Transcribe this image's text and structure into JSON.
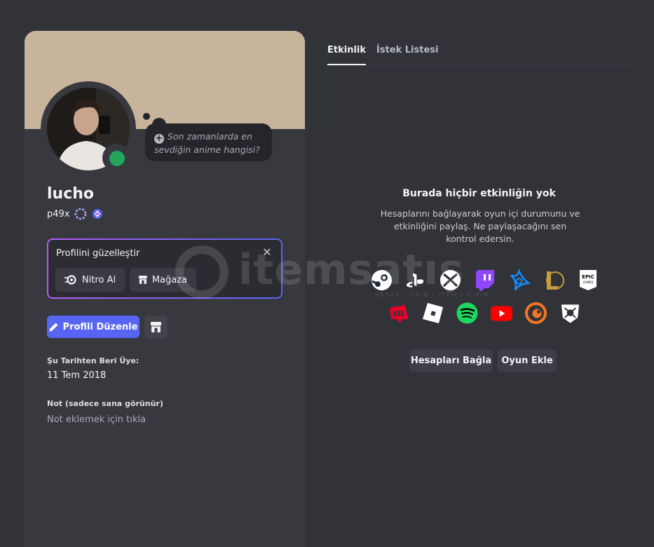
{
  "profile": {
    "display_name": "lucho",
    "username": "p49x",
    "status_prompt": "Son zamanlarda en sevdiğin anime hangisi?",
    "customize_title": "Profilini güzelleştir",
    "nitro_label": "Nitro Al",
    "shop_label": "Mağaza",
    "edit_label": "Profili Düzenle",
    "member_since_label": "Şu Tarihten Beri Üye:",
    "member_since_value": "11 Tem 2018",
    "note_label": "Not (sadece sana görünür)",
    "note_placeholder": "Not eklemek için tıkla",
    "status": "online"
  },
  "tabs": [
    {
      "label": "Etkinlik",
      "active": true
    },
    {
      "label": "İstek Listesi",
      "active": false
    }
  ],
  "activity": {
    "empty_title": "Burada hiçbir etkinliğin yok",
    "empty_desc": "Hesaplarını bağlayarak oyun içi durumunu ve etkinliğini paylaş. Ne paylaşacağını sen kontrol edersin.",
    "connect_label": "Hesapları Bağla",
    "add_game_label": "Oyun Ekle",
    "services_row1": [
      "steam-icon",
      "playstation-icon",
      "xbox-icon",
      "twitch-icon",
      "battlenet-icon",
      "league-of-legends-icon",
      "epic-games-icon"
    ],
    "services_row2": [
      "riot-games-icon",
      "roblox-icon",
      "spotify-icon",
      "youtube-icon",
      "crunchyroll-icon",
      "bungie-icon"
    ]
  },
  "watermark": {
    "brand": "itemsatış",
    "tagline": "HESAP / SKIN / ITEM / E-PIN"
  },
  "colors": {
    "background": "#323339",
    "card": "#38383f",
    "banner": "#c7b49a",
    "accent": "#5865f2",
    "online": "#23a55a"
  }
}
